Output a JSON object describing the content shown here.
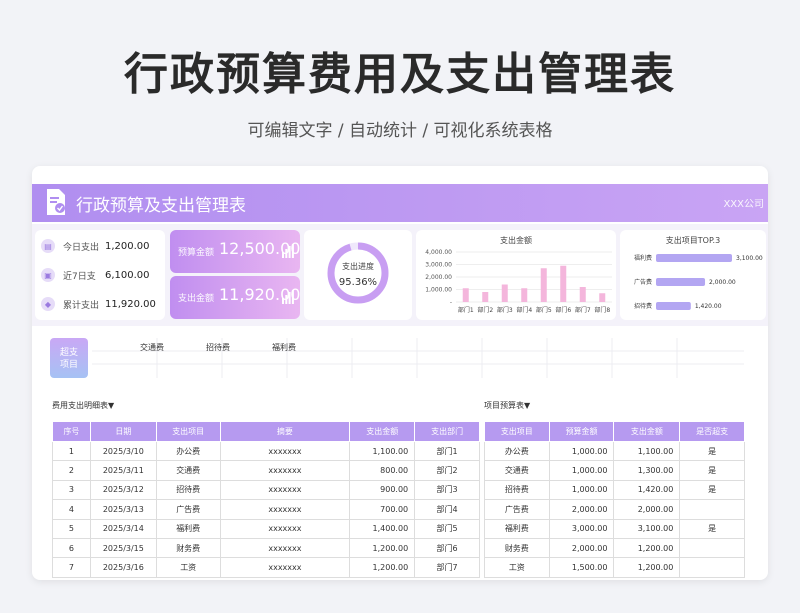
{
  "hero": {
    "title": "行政预算费用及支出管理表",
    "subtitle": "可编辑文字 / 自动统计 / 可视化系统表格"
  },
  "banner": {
    "title": "行政预算及支出管理表",
    "company": "XXX公司"
  },
  "stats": [
    {
      "icon": "calendar-icon",
      "label": "今日支出",
      "value": "1,200.00"
    },
    {
      "icon": "lock-icon",
      "label": "近7日支",
      "value": "6,100.00"
    },
    {
      "icon": "stack-icon",
      "label": "累计支出",
      "value": "11,920.00"
    }
  ],
  "kpis": [
    {
      "label": "预算金额",
      "value": "12,500.00"
    },
    {
      "label": "支出金额",
      "value": "11,920.00"
    }
  ],
  "progress": {
    "label": "支出进度",
    "value": "95.36%",
    "fraction": 0.9536
  },
  "chart_data": [
    {
      "type": "bar",
      "title": "支出金额",
      "categories": [
        "部门1",
        "部门2",
        "部门3",
        "部门4",
        "部门5",
        "部门6",
        "部门7",
        "部门8"
      ],
      "values": [
        1100,
        800,
        1400,
        1100,
        2700,
        2900,
        1200,
        700
      ],
      "yticks": [
        "4,000.00",
        "3,000.00",
        "2,000.00",
        "1,000.00",
        "-"
      ],
      "ylim": [
        0,
        4000
      ],
      "color": "#f4b6dc"
    },
    {
      "type": "bar",
      "title": "支出项目TOP.3",
      "categories": [
        "福利费",
        "广告费",
        "招待费"
      ],
      "values": [
        3100,
        2000,
        1420
      ],
      "labels": [
        "3,100.00",
        "2,000.00",
        "1,420.00"
      ],
      "max": 3100,
      "color": "#b3a6f2"
    }
  ],
  "category": {
    "tag_line1": "超支",
    "tag_line2": "项目",
    "items": [
      "交通费",
      "招待费",
      "福利费"
    ]
  },
  "detail": {
    "label": "费用支出明细表▼",
    "headers": [
      "序号",
      "日期",
      "支出项目",
      "摘要",
      "支出金额",
      "支出部门"
    ],
    "rows": [
      [
        "1",
        "2025/3/10",
        "办公费",
        "xxxxxxx",
        "1,100.00",
        "部门1"
      ],
      [
        "2",
        "2025/3/11",
        "交通费",
        "xxxxxxx",
        "800.00",
        "部门2"
      ],
      [
        "3",
        "2025/3/12",
        "招待费",
        "xxxxxxx",
        "900.00",
        "部门3"
      ],
      [
        "4",
        "2025/3/13",
        "广告费",
        "xxxxxxx",
        "700.00",
        "部门4"
      ],
      [
        "5",
        "2025/3/14",
        "福利费",
        "xxxxxxx",
        "1,400.00",
        "部门5"
      ],
      [
        "6",
        "2025/3/15",
        "财务费",
        "xxxxxxx",
        "1,200.00",
        "部门6"
      ],
      [
        "7",
        "2025/3/16",
        "工资",
        "xxxxxxx",
        "1,200.00",
        "部门7"
      ]
    ]
  },
  "budget": {
    "label": "项目预算表▼",
    "headers": [
      "支出项目",
      "预算金额",
      "支出金额",
      "是否超支"
    ],
    "rows": [
      [
        "办公费",
        "1,000.00",
        "1,100.00",
        "是"
      ],
      [
        "交通费",
        "1,000.00",
        "1,300.00",
        "是"
      ],
      [
        "招待费",
        "1,000.00",
        "1,420.00",
        "是"
      ],
      [
        "广告费",
        "2,000.00",
        "2,000.00",
        ""
      ],
      [
        "福利费",
        "3,000.00",
        "3,100.00",
        "是"
      ],
      [
        "财务费",
        "2,000.00",
        "1,200.00",
        ""
      ],
      [
        "工资",
        "1,500.00",
        "1,200.00",
        ""
      ]
    ]
  }
}
